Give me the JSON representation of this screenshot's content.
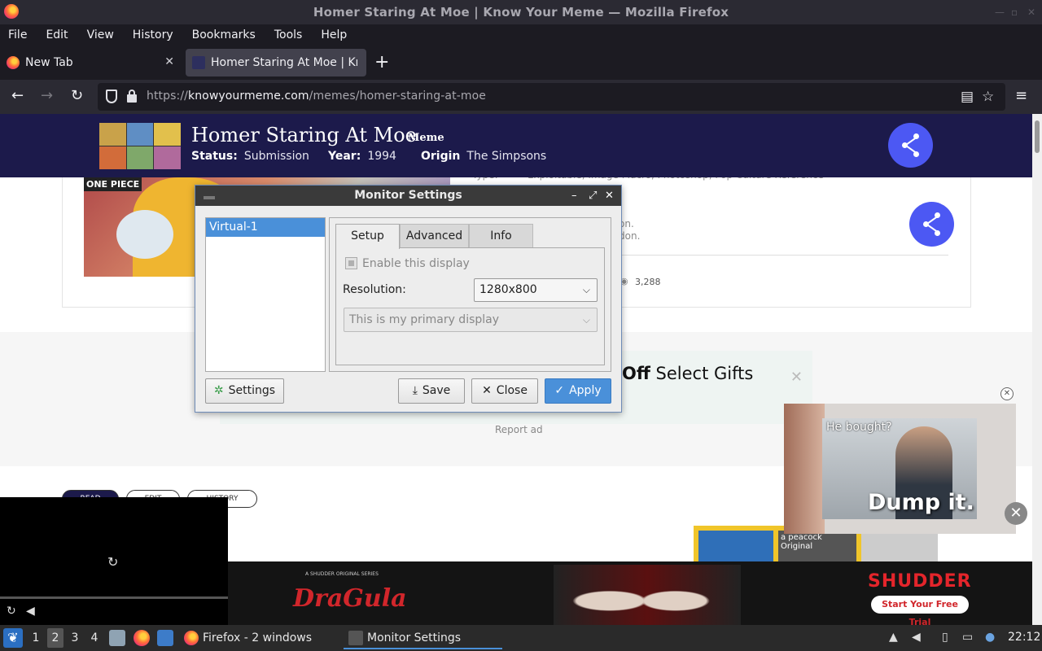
{
  "window": {
    "title": "Homer Staring At Moe | Know Your Meme — Mozilla Firefox"
  },
  "menubar": [
    "File",
    "Edit",
    "View",
    "History",
    "Bookmarks",
    "Tools",
    "Help"
  ],
  "tabs": [
    {
      "label": "New Tab"
    },
    {
      "label": "Homer Staring At Moe | Know Your Meme"
    }
  ],
  "urlbar": {
    "scheme": "https://",
    "host": "knowyourmeme.com",
    "path": "/memes/homer-staring-at-moe"
  },
  "kym": {
    "title": "Homer Staring At Moe",
    "type": "Meme",
    "status_label": "Status:",
    "status_value": "Submission",
    "year_label": "Year:",
    "year_value": "1994",
    "origin_label": "Origin",
    "origin_value": "The Simpsons",
    "image_logo": "ONE PIECE",
    "ghost_type": "Type:",
    "ghost_tags": "Exploitable, Image Macro, Photoshop, Pop Culture Reference",
    "ghost_on": "on.",
    "ghost_don": "don.",
    "views": "3,288",
    "pills": [
      "READ",
      "EDIT",
      "HISTORY"
    ]
  },
  "ads": {
    "banner_bold": "Off",
    "banner_rest": " Select Gifts",
    "report": "Report ad",
    "float_q": "He bought?",
    "float_caption": "Dump it.",
    "peacock": "a peacock Original",
    "bottom_series": "A SHUDDER ORIGINAL SERIES",
    "bottom_title": "DraGula",
    "bottom_brand": "SHUDDER",
    "bottom_cta": "Start Your Free Trial"
  },
  "dialog": {
    "title": "Monitor Settings",
    "displays": [
      "Virtual-1"
    ],
    "tabs": [
      "Setup",
      "Advanced",
      "Info"
    ],
    "enable_label": "Enable this display",
    "resolution_label": "Resolution:",
    "resolution_value": "1280x800",
    "primary_value": "This is my primary display",
    "settings_btn": "Settings",
    "save_btn": "Save",
    "close_btn": "Close",
    "apply_btn": "Apply"
  },
  "taskbar": {
    "workspaces": [
      "1",
      "2",
      "3",
      "4"
    ],
    "active_workspace": "2",
    "tasks": [
      "Firefox - 2 windows",
      "Monitor Settings"
    ],
    "clock": "22:12"
  },
  "colors": {
    "kym_header": "#1c1a4b",
    "share_button": "#4c58f3",
    "dialog_selection": "#4a90d9",
    "shudder_red": "#e4252b"
  }
}
